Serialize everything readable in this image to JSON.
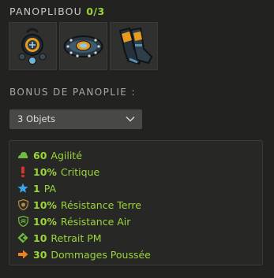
{
  "set": {
    "name": "PANOPLIBOU",
    "count": "0/3"
  },
  "items": [
    {
      "icon": "amulet-icon"
    },
    {
      "icon": "belt-icon"
    },
    {
      "icon": "boots-icon"
    }
  ],
  "bonus_title": "BONUS DE PANOPLIE :",
  "select": {
    "value": "3 Objets"
  },
  "bonuses": [
    {
      "value": "60",
      "label": "Agilité",
      "icon": "agility-icon",
      "color": "#6fbd3c"
    },
    {
      "value": "10%",
      "label": "Critique",
      "icon": "critical-icon",
      "color": "#d9312b"
    },
    {
      "value": "1",
      "label": "PA",
      "icon": "ap-star-icon",
      "color": "#3aa6e8"
    },
    {
      "value": "10%",
      "label": "Résistance Terre",
      "icon": "earth-resistance-icon",
      "color": "#8a6d3a"
    },
    {
      "value": "10%",
      "label": "Résistance Air",
      "icon": "air-resistance-icon",
      "color": "#6fbd3c"
    },
    {
      "value": "10",
      "label": "Retrait PM",
      "icon": "mp-reduction-icon",
      "color": "#6fbd3c"
    },
    {
      "value": "30",
      "label": "Dommages Poussée",
      "icon": "pushback-arrow-icon",
      "color": "#f0811e"
    }
  ],
  "colors": {
    "accent_green": "#9bd53a",
    "background": "#222321",
    "slot": "#30312e"
  }
}
